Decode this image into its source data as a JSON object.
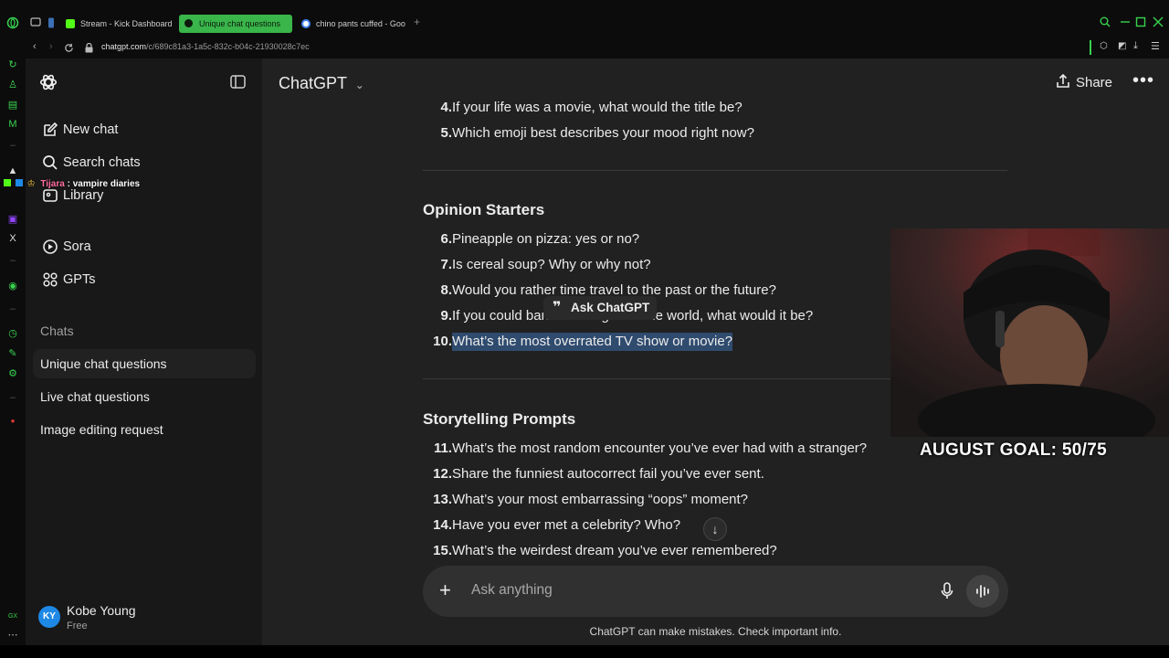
{
  "browser": {
    "tabs": [
      {
        "label": "Stream - Kick Dashboard",
        "icon": "kick-icon",
        "color": "#53fc18"
      },
      {
        "label": "Unique chat questions",
        "icon": "chatgpt-icon",
        "color": "#39b54a"
      },
      {
        "label": "chino pants cuffed - Goog",
        "icon": "google-icon",
        "color": "#4285f4"
      }
    ],
    "url_host": "chatgpt.com",
    "url_path": "/c/689c81a3-1a5c-832c-b04c-21930028c7ec",
    "accent": "#39d24f"
  },
  "sidebar": {
    "primary": [
      {
        "label": "New chat",
        "icon": "new-chat-icon"
      },
      {
        "label": "Search chats",
        "icon": "search-icon"
      },
      {
        "label": "Library",
        "icon": "library-icon"
      },
      {
        "label": "Sora",
        "icon": "sora-icon"
      },
      {
        "label": "GPTs",
        "icon": "gpts-icon"
      }
    ],
    "chats_heading": "Chats",
    "chats": [
      {
        "label": "Unique chat questions",
        "active": true
      },
      {
        "label": "Live chat questions",
        "active": false
      },
      {
        "label": "Image editing request",
        "active": false
      }
    ],
    "profile": {
      "initials": "KY",
      "name": "Kobe Young",
      "plan": "Free"
    }
  },
  "header": {
    "model": "ChatGPT",
    "share_label": "Share",
    "more_label": "•••"
  },
  "conversation": {
    "items_top": [
      {
        "num": "4.",
        "text": "If your life was a movie, what would the title be?"
      },
      {
        "num": "5.",
        "text": "Which emoji best describes your mood right now?"
      }
    ],
    "section1_title": "Opinion Starters",
    "section1": [
      {
        "num": "6.",
        "text": "Pineapple on pizza: yes or no?"
      },
      {
        "num": "7.",
        "text": "Is cereal soup? Why or why not?"
      },
      {
        "num": "8.",
        "text": "Would you rather time travel to the past or the future?"
      },
      {
        "num": "9.",
        "text": "If you could ban one thing from the world, what would it be?"
      },
      {
        "num": "10.",
        "text": "What’s the most overrated TV show or movie?",
        "highlighted": true
      }
    ],
    "section2_title": "Storytelling Prompts",
    "section2": [
      {
        "num": "11.",
        "text": "What’s the most random encounter you’ve ever had with a stranger?"
      },
      {
        "num": "12.",
        "text": "Share the funniest autocorrect fail you’ve ever sent."
      },
      {
        "num": "13.",
        "text": "What’s your most embarrassing “oops” moment?"
      },
      {
        "num": "14.",
        "text": "Have you ever met a celebrity? Who?"
      },
      {
        "num": "15.",
        "text": "What’s the weirdest dream you’ve ever remembered?"
      }
    ],
    "ask_chip_label": "Ask ChatGPT"
  },
  "composer": {
    "placeholder": "Ask anything",
    "disclaimer": "ChatGPT can make mistakes. Check important info."
  },
  "overlay": {
    "chat_user": "Tijara",
    "chat_message": ": vampire diaries",
    "goal_text": "AUGUST GOAL: 50/75"
  }
}
